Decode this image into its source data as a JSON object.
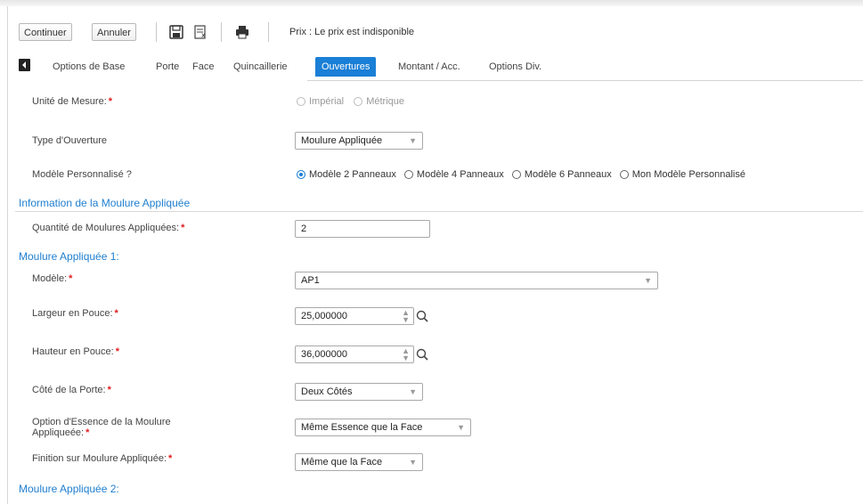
{
  "toolbar": {
    "continue_label": "Continuer",
    "cancel_label": "Annuler",
    "price_text": "Prix : Le prix est indisponible"
  },
  "tabs": [
    {
      "label": "Options de Base"
    },
    {
      "label": "Porte"
    },
    {
      "label": "Face"
    },
    {
      "label": "Quincaillerie"
    },
    {
      "label": "Ouvertures"
    },
    {
      "label": "Montant / Acc."
    },
    {
      "label": "Options Div."
    }
  ],
  "form": {
    "unit": {
      "label": "Unité de Mesure:",
      "options": [
        "Impérial",
        "Métrique"
      ]
    },
    "opening_type": {
      "label": "Type d'Ouverture",
      "value": "Moulure Appliquée"
    },
    "custom_model": {
      "label": "Modèle Personnalisé ?",
      "options": [
        "Modèle 2 Panneaux",
        "Modèle 4 Panneaux",
        "Modèle 6 Panneaux",
        "Mon Modèle Personnalisé"
      ]
    }
  },
  "section_info": {
    "title": "Information de la Moulure Appliquée",
    "qty_label": "Quantité de Moulures Appliquées:",
    "qty_value": "2"
  },
  "molding1": {
    "title": "Moulure Appliquée 1:",
    "model_label": "Modèle:",
    "model_value": "AP1",
    "width_label": "Largeur en Pouce:",
    "width_value": "25,000000",
    "height_label": "Hauteur en Pouce:",
    "height_value": "36,000000",
    "side_label": "Côté de la Porte:",
    "side_value": "Deux Côtés",
    "essence_label_1": "Option d'Essence de la Moulure",
    "essence_label_2": "Appliqueée:",
    "essence_value": "Même Essence que la Face",
    "finish_label": "Finition sur Moulure Appliquée:",
    "finish_value": "Même que la Face"
  },
  "molding2": {
    "title": "Moulure Appliquée 2:"
  },
  "colors": {
    "accent": "#1a7fd6",
    "required": "#e21b1b",
    "section": "#1f7fcf"
  }
}
